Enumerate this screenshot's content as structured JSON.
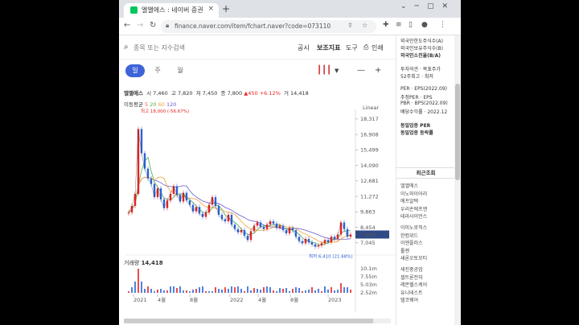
{
  "browser": {
    "tab_title": "엘앨에스 : 네이버 증권",
    "tab_close": "×",
    "new_tab": "+",
    "url": "finance.naver.com/item/fchart.naver?code=073110",
    "nav_back": "←",
    "nav_forward": "→",
    "nav_reload": "↻"
  },
  "toolbar": {
    "search_placeholder": "종목 또는 지수검색",
    "menu": [
      "공시",
      "보조지표",
      "도구",
      "인쇄"
    ]
  },
  "period": {
    "tabs": [
      "일",
      "주",
      "월"
    ],
    "selected": "일"
  },
  "quote": {
    "name": "엘앨에스",
    "open_label": "시",
    "open": "7,460",
    "high_label": "고",
    "high": "7,820",
    "low_label": "저",
    "low": "7,450",
    "close_label": "종",
    "close": "7,800",
    "change": "▲450 +6.12%",
    "volume_label": "거",
    "volume": "14,418"
  },
  "moving_avg": {
    "label": "이동평균",
    "periods": [
      "5",
      "20",
      "60",
      "120"
    ]
  },
  "scale_label": "Linear",
  "chart_data": {
    "type": "line",
    "yticks": [
      7045,
      7800,
      8454,
      9863,
      11272,
      12681,
      14090,
      15499,
      16908,
      18317
    ],
    "ylim": [
      6300,
      18600
    ],
    "xticks": [
      "2021",
      "4월",
      "8월",
      "2022",
      "4월",
      "8월",
      "2023"
    ],
    "price_tag": "7,800",
    "high_annotation": "최고 18,000 (-56.67%)",
    "low_annotation": "최저 6,410 (21.68%)",
    "volume_title": "거래량",
    "volume_value": "14,418",
    "volume_ticks": [
      "10.1m",
      "7.55m",
      "5.03m",
      "2.52m"
    ],
    "series": [
      {
        "values": [
          9800,
          10400,
          11500,
          17400,
          15200,
          13800,
          12900,
          12400,
          11200,
          12000,
          11000,
          10200,
          10900,
          11500,
          12200,
          11400,
          10800,
          11600,
          10900,
          10500,
          9900,
          10300,
          9700,
          9400,
          9800,
          10500,
          11200,
          10400,
          9600,
          9200,
          9000,
          9600,
          8700,
          8300,
          8000,
          8200,
          7700,
          7300,
          8100,
          8600,
          8900,
          8500,
          8300,
          8700,
          9000,
          8800,
          8400,
          8600,
          8200,
          7900,
          8400,
          8200,
          7600,
          7200,
          7000,
          7400,
          7100,
          6900,
          6700,
          6800,
          7000,
          7300,
          7100,
          7600,
          7400,
          7800,
          8900,
          8300,
          7600,
          7800
        ]
      }
    ]
  },
  "side": {
    "lines_top": [
      "외국인한도주식수(A)",
      "외국인보유주식수(B)",
      "외국인소진율(B/A)"
    ],
    "lines_mid": [
      "투자의견 · 목표주가",
      "52주최고 · 최저"
    ],
    "lines_per": [
      "PER · EPS(2022.09)",
      "추정PER · EPS",
      "PBR · BPS(2022.09)",
      "배당수익률 · 2022.12"
    ],
    "lines_peer": [
      "동일업종 PER",
      "동일업종 등락률"
    ],
    "recent_title": "최근조회",
    "recent": [
      "엘앨에스",
      "이노와이어리",
      "에프알텍",
      "우리손에프앤",
      "테라사이언스",
      "이미노로직스",
      "한컴위드",
      "이엔플러스",
      "툴젠",
      "새론오토모티",
      "세진중공업",
      "셀트론전자",
      "레몬헬스케어",
      "유니테스트",
      "텔코웨어"
    ]
  },
  "colors": {
    "up": "#e22222",
    "accent": "#3d63d8",
    "price_tag": "#304a86",
    "ma5": "#e9604a",
    "ma20": "#58a84d",
    "ma60": "#f0a030",
    "ma120": "#6a5acd"
  }
}
